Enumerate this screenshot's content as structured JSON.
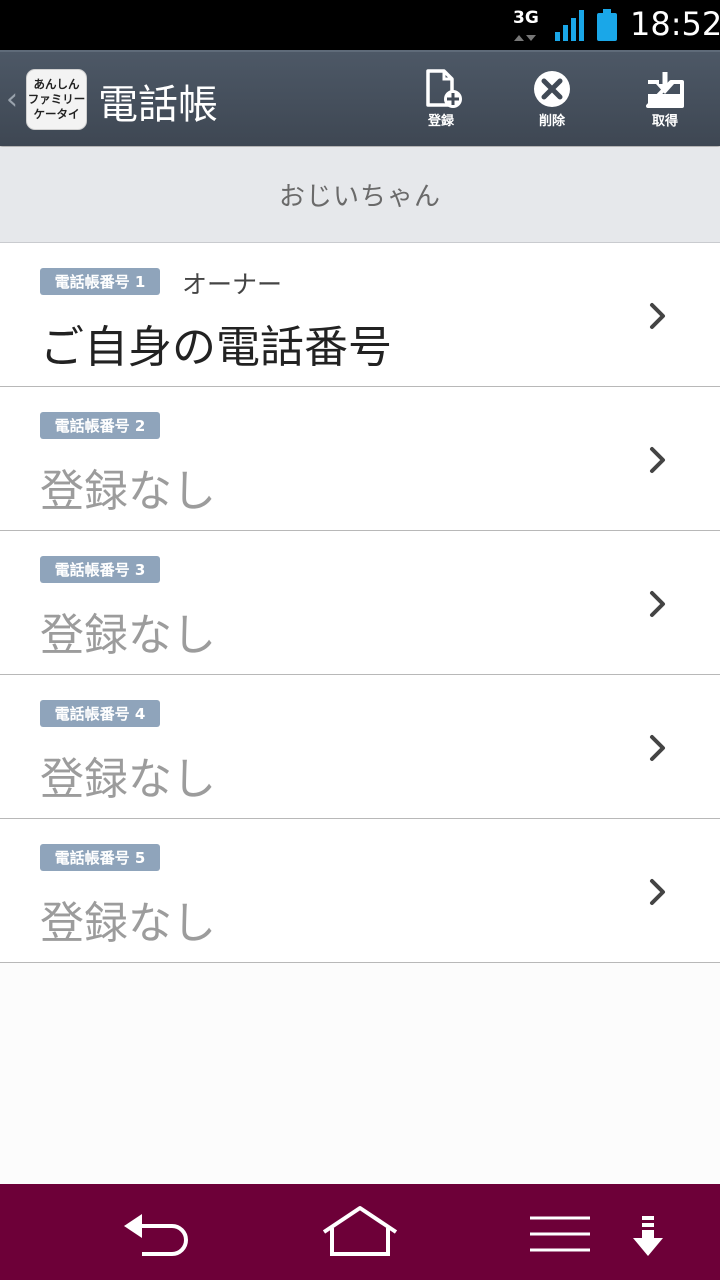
{
  "status_bar": {
    "network": "3G",
    "time": "18:52",
    "signal_icon": "signal-bars-icon",
    "battery_icon": "battery-icon",
    "accent_color": "#1aa7e8"
  },
  "action_bar": {
    "logo_text": "あんしん\nファミリー\nケータイ",
    "title": "電話帳",
    "actions": [
      {
        "label": "登録",
        "icon": "add-document-icon"
      },
      {
        "label": "削除",
        "icon": "delete-circle-icon"
      },
      {
        "label": "取得",
        "icon": "download-tray-icon"
      }
    ]
  },
  "profile": {
    "name": "おじいちゃん"
  },
  "entries": [
    {
      "badge": "電話帳番号 1",
      "owner": "オーナー",
      "main": "ご自身の電話番号"
    },
    {
      "badge": "電話帳番号 2",
      "owner": "",
      "main": "登録なし"
    },
    {
      "badge": "電話帳番号 3",
      "owner": "",
      "main": "登録なし"
    },
    {
      "badge": "電話帳番号 4",
      "owner": "",
      "main": "登録なし"
    },
    {
      "badge": "電話帳番号 5",
      "owner": "",
      "main": "登録なし"
    }
  ],
  "nav_bar": {
    "color": "#6d0038",
    "buttons": [
      "back-icon",
      "home-icon",
      "menu-icon",
      "down-arrow-icon"
    ]
  }
}
